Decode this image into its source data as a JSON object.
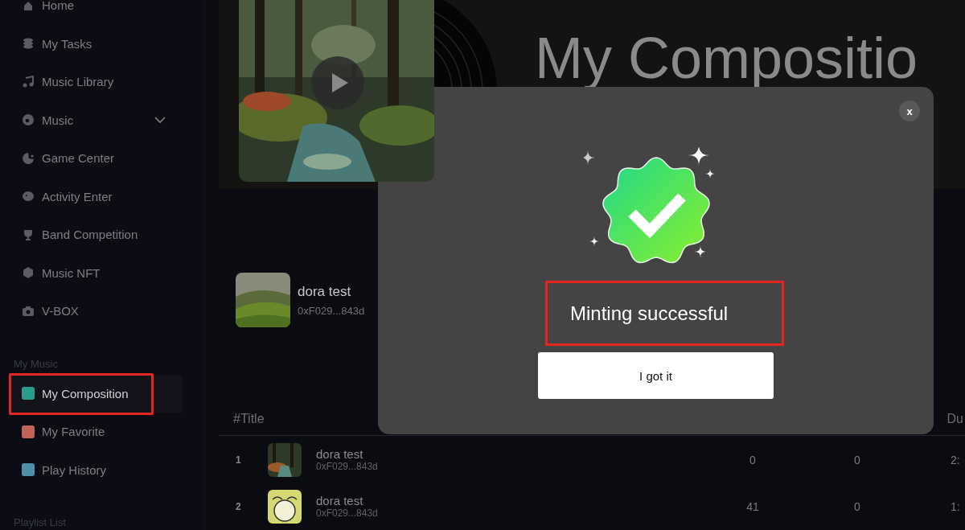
{
  "sidebar": {
    "nav": [
      {
        "label": "Home",
        "kind": "link",
        "selected": false,
        "highlighted": false
      },
      {
        "label": "My Tasks",
        "kind": "link",
        "selected": false,
        "highlighted": false
      },
      {
        "label": "Music Library",
        "kind": "link",
        "selected": false,
        "highlighted": false
      },
      {
        "label": "Music",
        "kind": "expandable",
        "selected": false,
        "highlighted": false
      },
      {
        "label": "Game Center",
        "kind": "link",
        "selected": false,
        "highlighted": false
      },
      {
        "label": "Activity Enter",
        "kind": "link",
        "selected": false,
        "highlighted": false
      },
      {
        "label": "Band Competition",
        "kind": "link",
        "selected": false,
        "highlighted": false
      },
      {
        "label": "Music NFT",
        "kind": "link",
        "selected": false,
        "highlighted": false
      },
      {
        "label": "V-BOX",
        "kind": "link",
        "selected": false,
        "highlighted": false
      }
    ],
    "my_music": {
      "heading": "My Music",
      "items": [
        {
          "label": "My Composition",
          "color": "#2a9d8f",
          "selected": true,
          "highlighted": true
        },
        {
          "label": "My Favorite",
          "color": "#c0645a",
          "selected": false,
          "highlighted": false
        },
        {
          "label": "Play History",
          "color": "#4f8fa8",
          "selected": false,
          "highlighted": false
        }
      ]
    },
    "playlist_heading": "Playlist List"
  },
  "banner": {
    "title": "My Compositio"
  },
  "album": {
    "title": "dora test",
    "address": "0xF029...843d"
  },
  "table": {
    "columns": [
      "#Title",
      "Du"
    ],
    "rows": [
      {
        "index": "1",
        "title": "dora test",
        "address": "0xF029...843d",
        "column_2": "0",
        "column_3": "0",
        "column_4": "2:"
      },
      {
        "index": "2",
        "title": "dora test",
        "address": "0xF029...843d",
        "column_2": "41",
        "column_3": "0",
        "column_4": "1:"
      }
    ]
  },
  "modal": {
    "close": "x",
    "message": "Minting successful",
    "highlighted": true,
    "button": "I got it"
  }
}
